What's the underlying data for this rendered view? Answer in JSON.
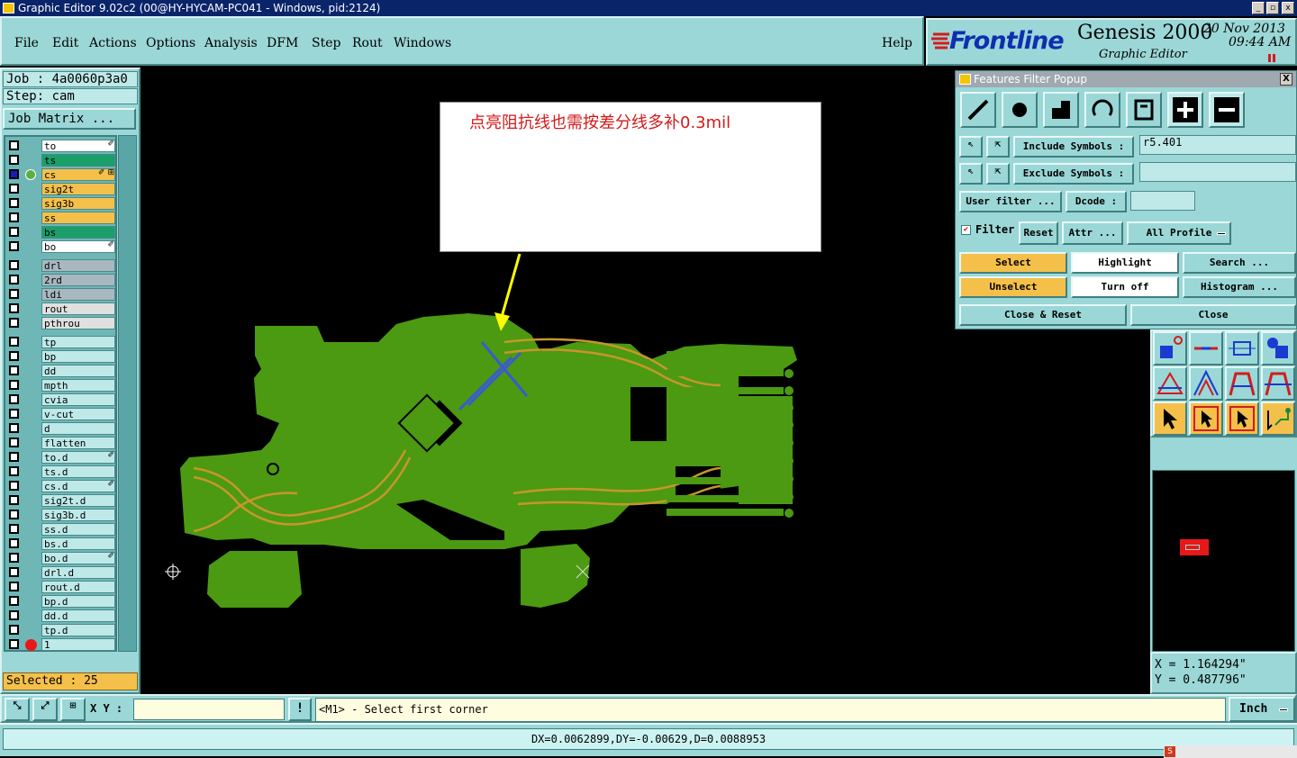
{
  "window": {
    "title": "Graphic Editor 9.02c2 (00@HY-HYCAM-PC041 - Windows, pid:2124)",
    "min": "_",
    "max": "▫",
    "close": "x"
  },
  "menu": {
    "items": [
      "File",
      "Edit",
      "Actions",
      "Options",
      "Analysis",
      "DFM",
      "Step",
      "Rout",
      "Windows"
    ],
    "help": "Help"
  },
  "logo": {
    "brand": "Frontline",
    "product": "Genesis 2000",
    "subtitle": "Graphic Editor",
    "date": "20 Nov 2013",
    "time": "09:44 AM"
  },
  "job": {
    "job_label": "Job : 4a0060p3a0",
    "step_label": "Step: cam",
    "matrix_button": "Job Matrix ..."
  },
  "layers": {
    "group1": [
      {
        "name": "to",
        "color": "#ffffff",
        "mark": "✐"
      },
      {
        "name": "ts",
        "color": "#1a9f6a",
        "mark": ""
      },
      {
        "name": "cs",
        "color": "#f5c04a",
        "mark": "✐ ⊞"
      },
      {
        "name": "sig2t",
        "color": "#f5c04a",
        "mark": ""
      },
      {
        "name": "sig3b",
        "color": "#f5c04a",
        "mark": ""
      },
      {
        "name": "ss",
        "color": "#f5c04a",
        "mark": ""
      },
      {
        "name": "bs",
        "color": "#1a9f6a",
        "mark": ""
      },
      {
        "name": "bo",
        "color": "#ffffff",
        "mark": "✐"
      }
    ],
    "group2": [
      {
        "name": "drl",
        "color": "#a8b8c0"
      },
      {
        "name": "2rd",
        "color": "#a8b8c0"
      },
      {
        "name": "ldi",
        "color": "#a8b8c0"
      },
      {
        "name": "rout",
        "color": "#e0e0e0"
      },
      {
        "name": "pthrou",
        "color": "#e0e0e0"
      }
    ],
    "group3": [
      {
        "name": "tp",
        "mark": ""
      },
      {
        "name": "bp",
        "mark": ""
      },
      {
        "name": "dd",
        "mark": ""
      },
      {
        "name": "mpth",
        "mark": ""
      },
      {
        "name": "cvia",
        "mark": ""
      },
      {
        "name": "v-cut",
        "mark": ""
      },
      {
        "name": "d",
        "mark": ""
      },
      {
        "name": "flatten",
        "mark": ""
      },
      {
        "name": "to.d",
        "mark": "✐"
      },
      {
        "name": "ts.d",
        "mark": ""
      },
      {
        "name": "cs.d",
        "mark": "✐"
      },
      {
        "name": "sig2t.d",
        "mark": ""
      },
      {
        "name": "sig3b.d",
        "mark": ""
      },
      {
        "name": "ss.d",
        "mark": ""
      },
      {
        "name": "bs.d",
        "mark": ""
      },
      {
        "name": "bo.d",
        "mark": "✐"
      },
      {
        "name": "drl.d",
        "mark": ""
      },
      {
        "name": "rout.d",
        "mark": ""
      },
      {
        "name": "bp.d",
        "mark": ""
      },
      {
        "name": "dd.d",
        "mark": ""
      },
      {
        "name": "tp.d",
        "mark": ""
      },
      {
        "name": "1",
        "mark": ""
      }
    ],
    "selected_label": "Selected : 25"
  },
  "annotation": {
    "text": "点亮阻抗线也需按差分线多补0.3mil"
  },
  "filter_popup": {
    "title": "Features Filter Popup",
    "close": "X",
    "include_label": "Include Symbols :",
    "include_value": "r5.401",
    "exclude_label": "Exclude Symbols :",
    "exclude_value": "",
    "user_filter": "User filter ...",
    "dcode_label": "Dcode :",
    "dcode_value": "",
    "filter_label": "Filter",
    "reset": "Reset",
    "attr": "Attr ...",
    "profile": "All Profile",
    "select": "Select",
    "highlight": "Highlight",
    "search": "Search ...",
    "unselect": "Unselect",
    "turn_off": "Turn off",
    "histogram": "Histogram ...",
    "close_reset": "Close & Reset",
    "close_btn": "Close"
  },
  "coords": {
    "x": "X = 1.164294\"",
    "y": "Y = 0.487796\""
  },
  "status": {
    "xy_label": "X Y :",
    "xy_value": "",
    "message": "<M1> - Select first corner",
    "units": "Inch",
    "info": "!"
  },
  "bottom": {
    "delta": "DX=0.0062899,DY=-0.00629,D=0.0088953"
  },
  "colors": {
    "panel": "#9bd7d7",
    "board": "#4b9a12",
    "trace": "#c8962a",
    "highlight": "#3a5ad0",
    "select_btn": "#f5c04a"
  }
}
